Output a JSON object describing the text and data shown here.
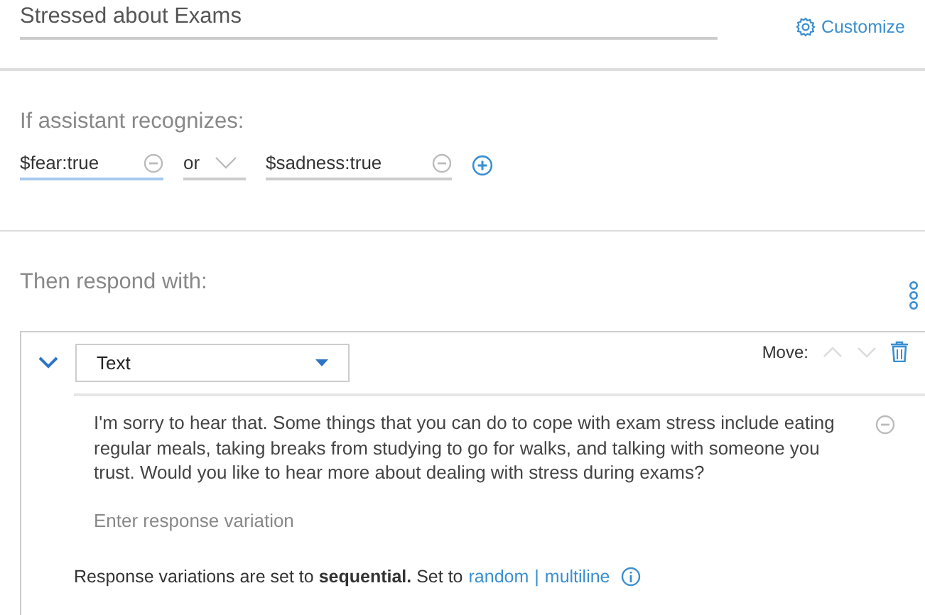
{
  "title": "Stressed about Exams",
  "customize": "Customize",
  "condition": {
    "label": "If assistant recognizes:",
    "items": [
      {
        "value": "$fear:true",
        "focused": true
      },
      {
        "value": "$sadness:true",
        "focused": false
      }
    ],
    "connector": "or"
  },
  "response": {
    "label": "Then respond with:",
    "expanded": true,
    "type": "Text",
    "move_label": "Move:",
    "variations": [
      "I'm sorry to hear that. Some things that you can do to cope with exam stress include eating regular meals, taking breaks from studying to go for walks, and talking with someone you trust. Would you like to hear more about dealing with stress during exams?"
    ],
    "placeholder": "Enter response variation",
    "footer": {
      "text": "Response variations are set to **sequential.** Set to",
      "links": [
        "random",
        "multiline"
      ],
      "separator": "|"
    }
  }
}
